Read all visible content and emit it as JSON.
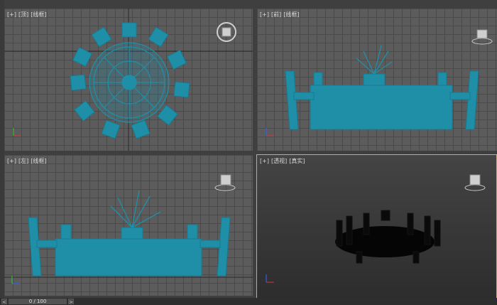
{
  "viewports": {
    "top": {
      "label": [
        "[+]",
        "[顶]",
        "[线框]"
      ]
    },
    "front": {
      "label": [
        "[+]",
        "[前]",
        "[线框]"
      ]
    },
    "left": {
      "label": [
        "[+]",
        "[左]",
        "[线框]"
      ]
    },
    "perspective": {
      "label": [
        "[+]",
        "[透视]",
        "[真实]"
      ]
    }
  },
  "timeline": {
    "frame": "0 / 100",
    "prev": "<",
    "next": ">"
  },
  "colors": {
    "wire": "#1f8fa8",
    "active_border": "#c9b24a",
    "grid": "#5c5c5c"
  },
  "icons": {
    "viewcube": "viewcube-icon",
    "axis": "axis-tripod-icon"
  }
}
